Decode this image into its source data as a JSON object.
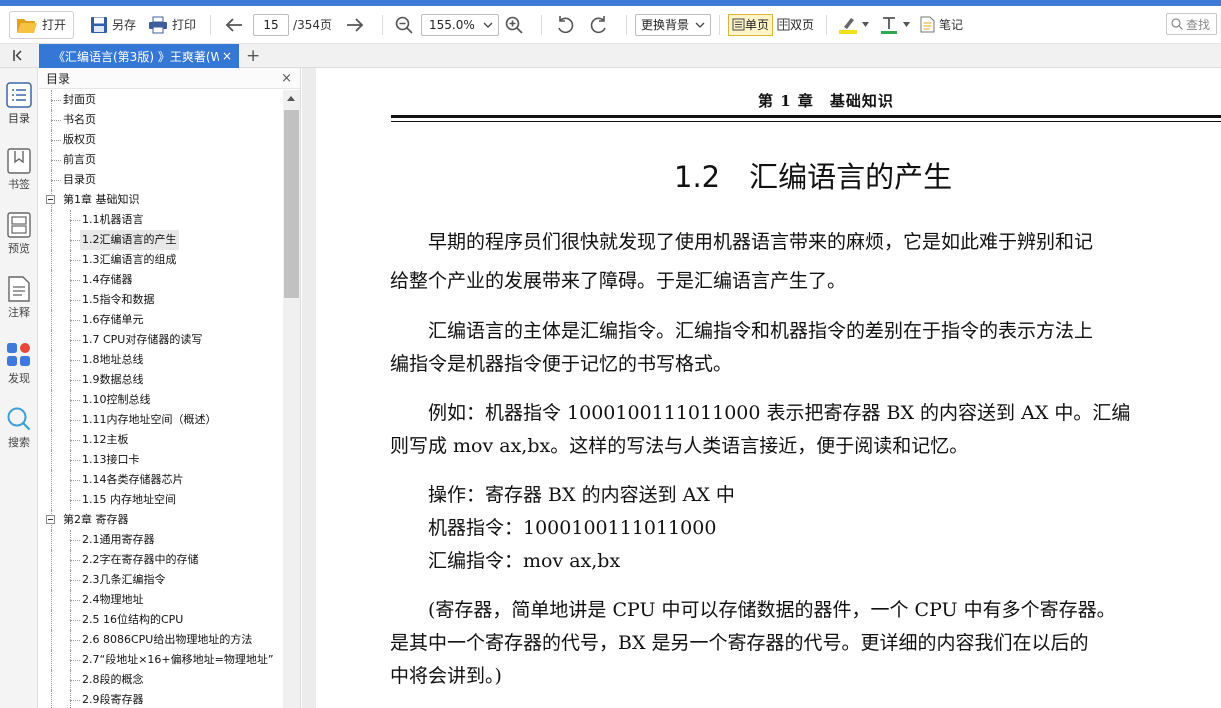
{
  "toolbar": {
    "open_label": "打开",
    "save_label": "另存",
    "print_label": "打印",
    "current_page": "15",
    "total_pages": "/354页",
    "zoom_value": "155.0%",
    "background_label": "更换背景",
    "single_page_label": "单页",
    "double_page_label": "双页",
    "note_label": "笔记",
    "search_placeholder": "查找"
  },
  "tab": {
    "title": "《汇编语言(第3版) 》王爽著(W",
    "close": "×",
    "new": "+"
  },
  "leftnav": [
    {
      "label": "目录",
      "icon": "list-icon"
    },
    {
      "label": "书签",
      "icon": "bookmark-icon"
    },
    {
      "label": "预览",
      "icon": "preview-icon"
    },
    {
      "label": "注释",
      "icon": "note-icon"
    },
    {
      "label": "发现",
      "icon": "discover-icon"
    },
    {
      "label": "搜索",
      "icon": "search-icon"
    }
  ],
  "toc": {
    "title": "目录",
    "close": "×",
    "items": [
      {
        "label": "封面页",
        "level": 0
      },
      {
        "label": "书名页",
        "level": 0
      },
      {
        "label": "版权页",
        "level": 0
      },
      {
        "label": "前言页",
        "level": 0
      },
      {
        "label": "目录页",
        "level": 0
      },
      {
        "label": "第1章 基础知识",
        "level": 0,
        "expanded": true
      },
      {
        "label": "1.1机器语言",
        "level": 1
      },
      {
        "label": "1.2汇编语言的产生",
        "level": 1,
        "selected": true
      },
      {
        "label": "1.3汇编语言的组成",
        "level": 1
      },
      {
        "label": "1.4存储器",
        "level": 1
      },
      {
        "label": "1.5指令和数据",
        "level": 1
      },
      {
        "label": "1.6存储单元",
        "level": 1
      },
      {
        "label": "1.7 CPU对存储器的读写",
        "level": 1
      },
      {
        "label": "1.8地址总线",
        "level": 1
      },
      {
        "label": "1.9数据总线",
        "level": 1
      },
      {
        "label": "1.10控制总线",
        "level": 1
      },
      {
        "label": "1.11内存地址空间（概述）",
        "level": 1
      },
      {
        "label": "1.12主板",
        "level": 1
      },
      {
        "label": "1.13接口卡",
        "level": 1
      },
      {
        "label": "1.14各类存储器芯片",
        "level": 1
      },
      {
        "label": "1.15 内存地址空间",
        "level": 1
      },
      {
        "label": "第2章 寄存器",
        "level": 0,
        "expanded": true
      },
      {
        "label": "2.1通用寄存器",
        "level": 1
      },
      {
        "label": "2.2字在寄存器中的存储",
        "level": 1
      },
      {
        "label": "2.3几条汇编指令",
        "level": 1
      },
      {
        "label": "2.4物理地址",
        "level": 1
      },
      {
        "label": "2.5 16位结构的CPU",
        "level": 1
      },
      {
        "label": "2.6 8086CPU给出物理地址的方法",
        "level": 1
      },
      {
        "label": "2.7“段地址×16+偏移地址=物理地址”",
        "level": 1
      },
      {
        "label": "2.8段的概念",
        "level": 1
      },
      {
        "label": "2.9段寄存器",
        "level": 1
      }
    ]
  },
  "page": {
    "running_head": "第 1 章　基础知识",
    "section_title": "1.2　汇编语言的产生",
    "lines": [
      "　　早期的程序员们很快就发现了使用机器语言带来的麻烦，它是如此难于辨别和记",
      "给整个产业的发展带来了障碍。于是汇编语言产生了。",
      "　　汇编语言的主体是汇编指令。汇编指令和机器指令的差别在于指令的表示方法上",
      "编指令是机器指令便于记忆的书写格式。",
      "　　例如：机器指令 1000100111011000 表示把寄存器 BX 的内容送到 AX 中。汇编",
      "则写成 mov ax,bx。这样的写法与人类语言接近，便于阅读和记忆。",
      "　　操作：寄存器 BX 的内容送到 AX 中",
      "　　机器指令：1000100111011000",
      "　　汇编指令：mov ax,bx",
      "　　(寄存器，简单地讲是 CPU 中可以存储数据的器件，一个 CPU 中有多个寄存器。",
      "是其中一个寄存器的代号，BX 是另一个寄存器的代号。更详细的内容我们在以后的",
      "中将会讲到。)"
    ]
  }
}
